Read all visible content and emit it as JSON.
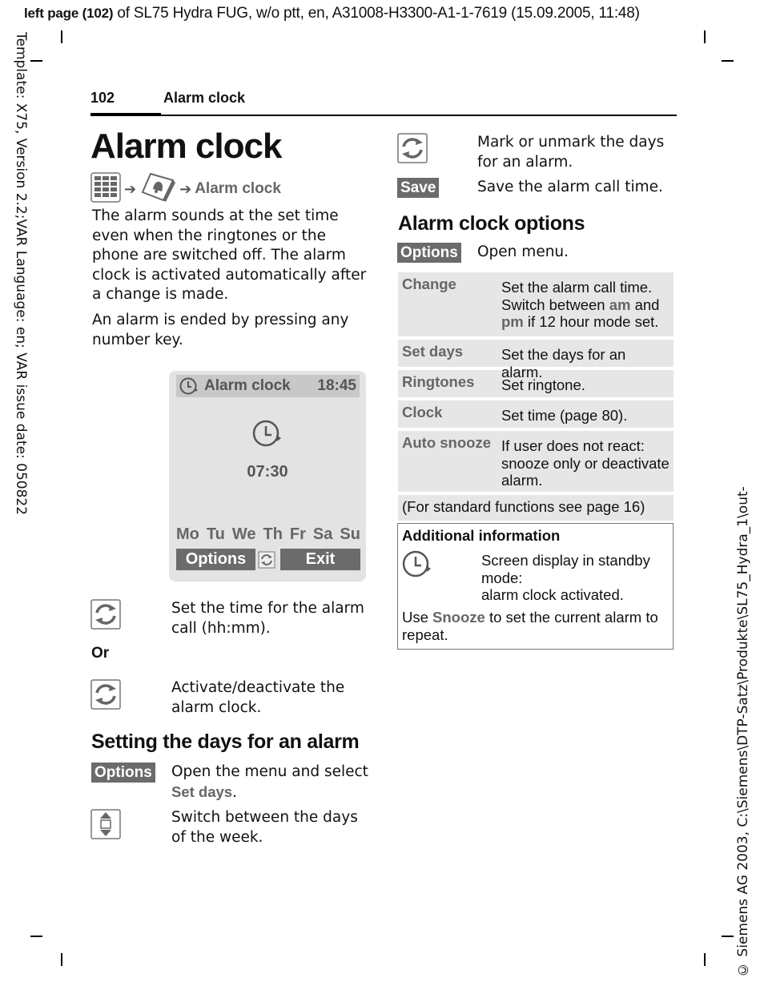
{
  "meta": {
    "top_prefix": "left page (102)",
    "top_suffix": " of SL75 Hydra FUG, w/o ptt, en, A31008-H3300-A1-1-7619 (15.09.2005, 11:48)",
    "left_margin": "Template: X75, Version 2.2;VAR Language: en; VAR issue date: 050822",
    "right_margin": "© Siemens AG 2003, C:\\Siemens\\DTP-Satz\\Produkte\\SL75_Hydra_1\\out-"
  },
  "running_header": {
    "page_number": "102",
    "title": "Alarm clock"
  },
  "page_title": "Alarm clock",
  "menu_path": {
    "icons": [
      "menu-grid-icon",
      "organiser-bell-icon"
    ],
    "target": "Alarm clock"
  },
  "intro": [
    "The alarm sounds at the set time even when the ringtones or the phone are switched off. The alarm clock is activated automatically after a change is made.",
    "An alarm is ended by pressing any number key."
  ],
  "phone_screen": {
    "title": "Alarm clock",
    "clock": "18:45",
    "alarm_time": "07:30",
    "days": [
      "Mo",
      "Tu",
      "We",
      "Th",
      "Fr",
      "Sa",
      "Su"
    ],
    "left_softkey": "Options",
    "right_softkey": "Exit"
  },
  "steps": [
    {
      "icon": "control-key-icon",
      "text": "Set the time for the alarm call (hh:mm)."
    },
    {
      "separator": "Or"
    },
    {
      "icon": "control-key-icon",
      "text": "Activate/deactivate the alarm clock."
    }
  ],
  "section_days": {
    "heading": "Setting the days for an alarm",
    "rows": [
      {
        "softkey": "Options",
        "text_before": "Open the menu and select ",
        "highlight": "Set days",
        "text_after": "."
      },
      {
        "icon": "navigation-key-icon",
        "text": "Switch between the days of the week."
      }
    ]
  },
  "right_steps": [
    {
      "icon": "control-key-icon",
      "text": "Mark or unmark the days for an alarm."
    },
    {
      "softkey": "Save",
      "text": "Save the alarm call time."
    }
  ],
  "section_options": {
    "heading": "Alarm clock options",
    "softkey": "Options",
    "softkey_text": "Open menu.",
    "table": [
      {
        "name": "Change",
        "desc_parts": [
          "Set the alarm call time. Switch between ",
          "am",
          " and ",
          "pm",
          " if 12 hour mode set."
        ]
      },
      {
        "name": "Set days",
        "desc": "Set the days for an alarm."
      },
      {
        "name": "Ringtones",
        "desc": "Set ringtone."
      },
      {
        "name": "Clock",
        "desc": "Set time (page 80)."
      },
      {
        "name": "Auto snooze",
        "desc": "If user does not react: snooze only or deactivate alarm."
      }
    ],
    "footer": "(For standard functions see page 16)"
  },
  "additional_info": {
    "title": "Additional information",
    "icon": "alarm-clock-icon",
    "desc_lines": [
      "Screen display in standby",
      "mode:",
      "alarm clock activated."
    ],
    "foot_before": "Use ",
    "foot_highlight": "Snooze",
    "foot_after": " to set the current alarm to repeat."
  },
  "colors": {
    "softkey_bg": "#6b6b6b",
    "highlight_text": "#666666",
    "table_bg": "#e6e6e6",
    "phone_bg": "#e3e3e3"
  }
}
